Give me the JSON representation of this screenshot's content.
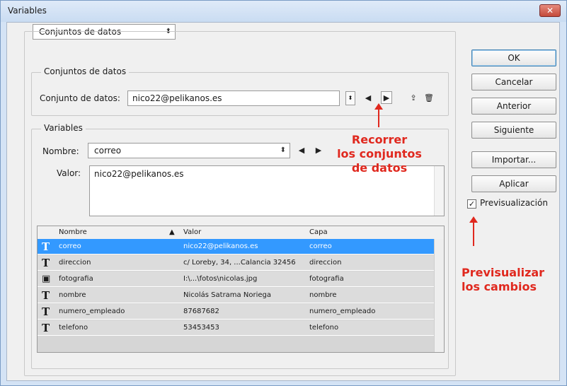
{
  "window": {
    "title": "Variables",
    "close_glyph": "✕"
  },
  "mode_dropdown": {
    "value": "Conjuntos de datos",
    "arrow": "⬍"
  },
  "datasets": {
    "group_label": "Conjuntos de datos",
    "field_label": "Conjunto de datos:",
    "value": "nico22@pelikanos.es",
    "icons": {
      "prev": "◀",
      "next": "▶",
      "apply": "⇪",
      "delete": "🗑"
    }
  },
  "variables": {
    "group_label": "Variables",
    "name_label": "Nombre:",
    "name_value": "correo",
    "value_label": "Valor:",
    "value": "nico22@pelikanos.es"
  },
  "table": {
    "headers": [
      "Nombre",
      "Valor",
      "Capa"
    ],
    "sort_glyph": "▲",
    "rows": [
      {
        "icon": "T",
        "name": "correo",
        "value": "nico22@pelikanos.es",
        "layer": "correo",
        "selected": true
      },
      {
        "icon": "T",
        "name": "direccion",
        "value": "c/ Loreby, 34, ...Calancia 32456",
        "layer": "direccion"
      },
      {
        "icon": "▣",
        "name": "fotografia",
        "value": "I:\\...\\fotos\\nicolas.jpg",
        "layer": "fotografia"
      },
      {
        "icon": "T",
        "name": "nombre",
        "value": "Nicolás Satrama Noriega",
        "layer": "nombre"
      },
      {
        "icon": "T",
        "name": "numero_empleado",
        "value": "87687682",
        "layer": "numero_empleado"
      },
      {
        "icon": "T",
        "name": "telefono",
        "value": "53453453",
        "layer": "telefono"
      }
    ]
  },
  "buttons": {
    "ok": "OK",
    "cancel": "Cancelar",
    "previous": "Anterior",
    "next": "Siguiente",
    "import": "Importar...",
    "apply": "Aplicar"
  },
  "preview": {
    "label": "Previsualización",
    "checked": true,
    "check_glyph": "✓"
  },
  "annotations": {
    "browse_line1": "Recorrer",
    "browse_line2": "los conjuntos",
    "browse_line3": "de datos",
    "preview_line1": "Previsualizar",
    "preview_line2": "los cambios"
  },
  "colors": {
    "selection": "#3399ff",
    "annotation": "#e0281e"
  }
}
